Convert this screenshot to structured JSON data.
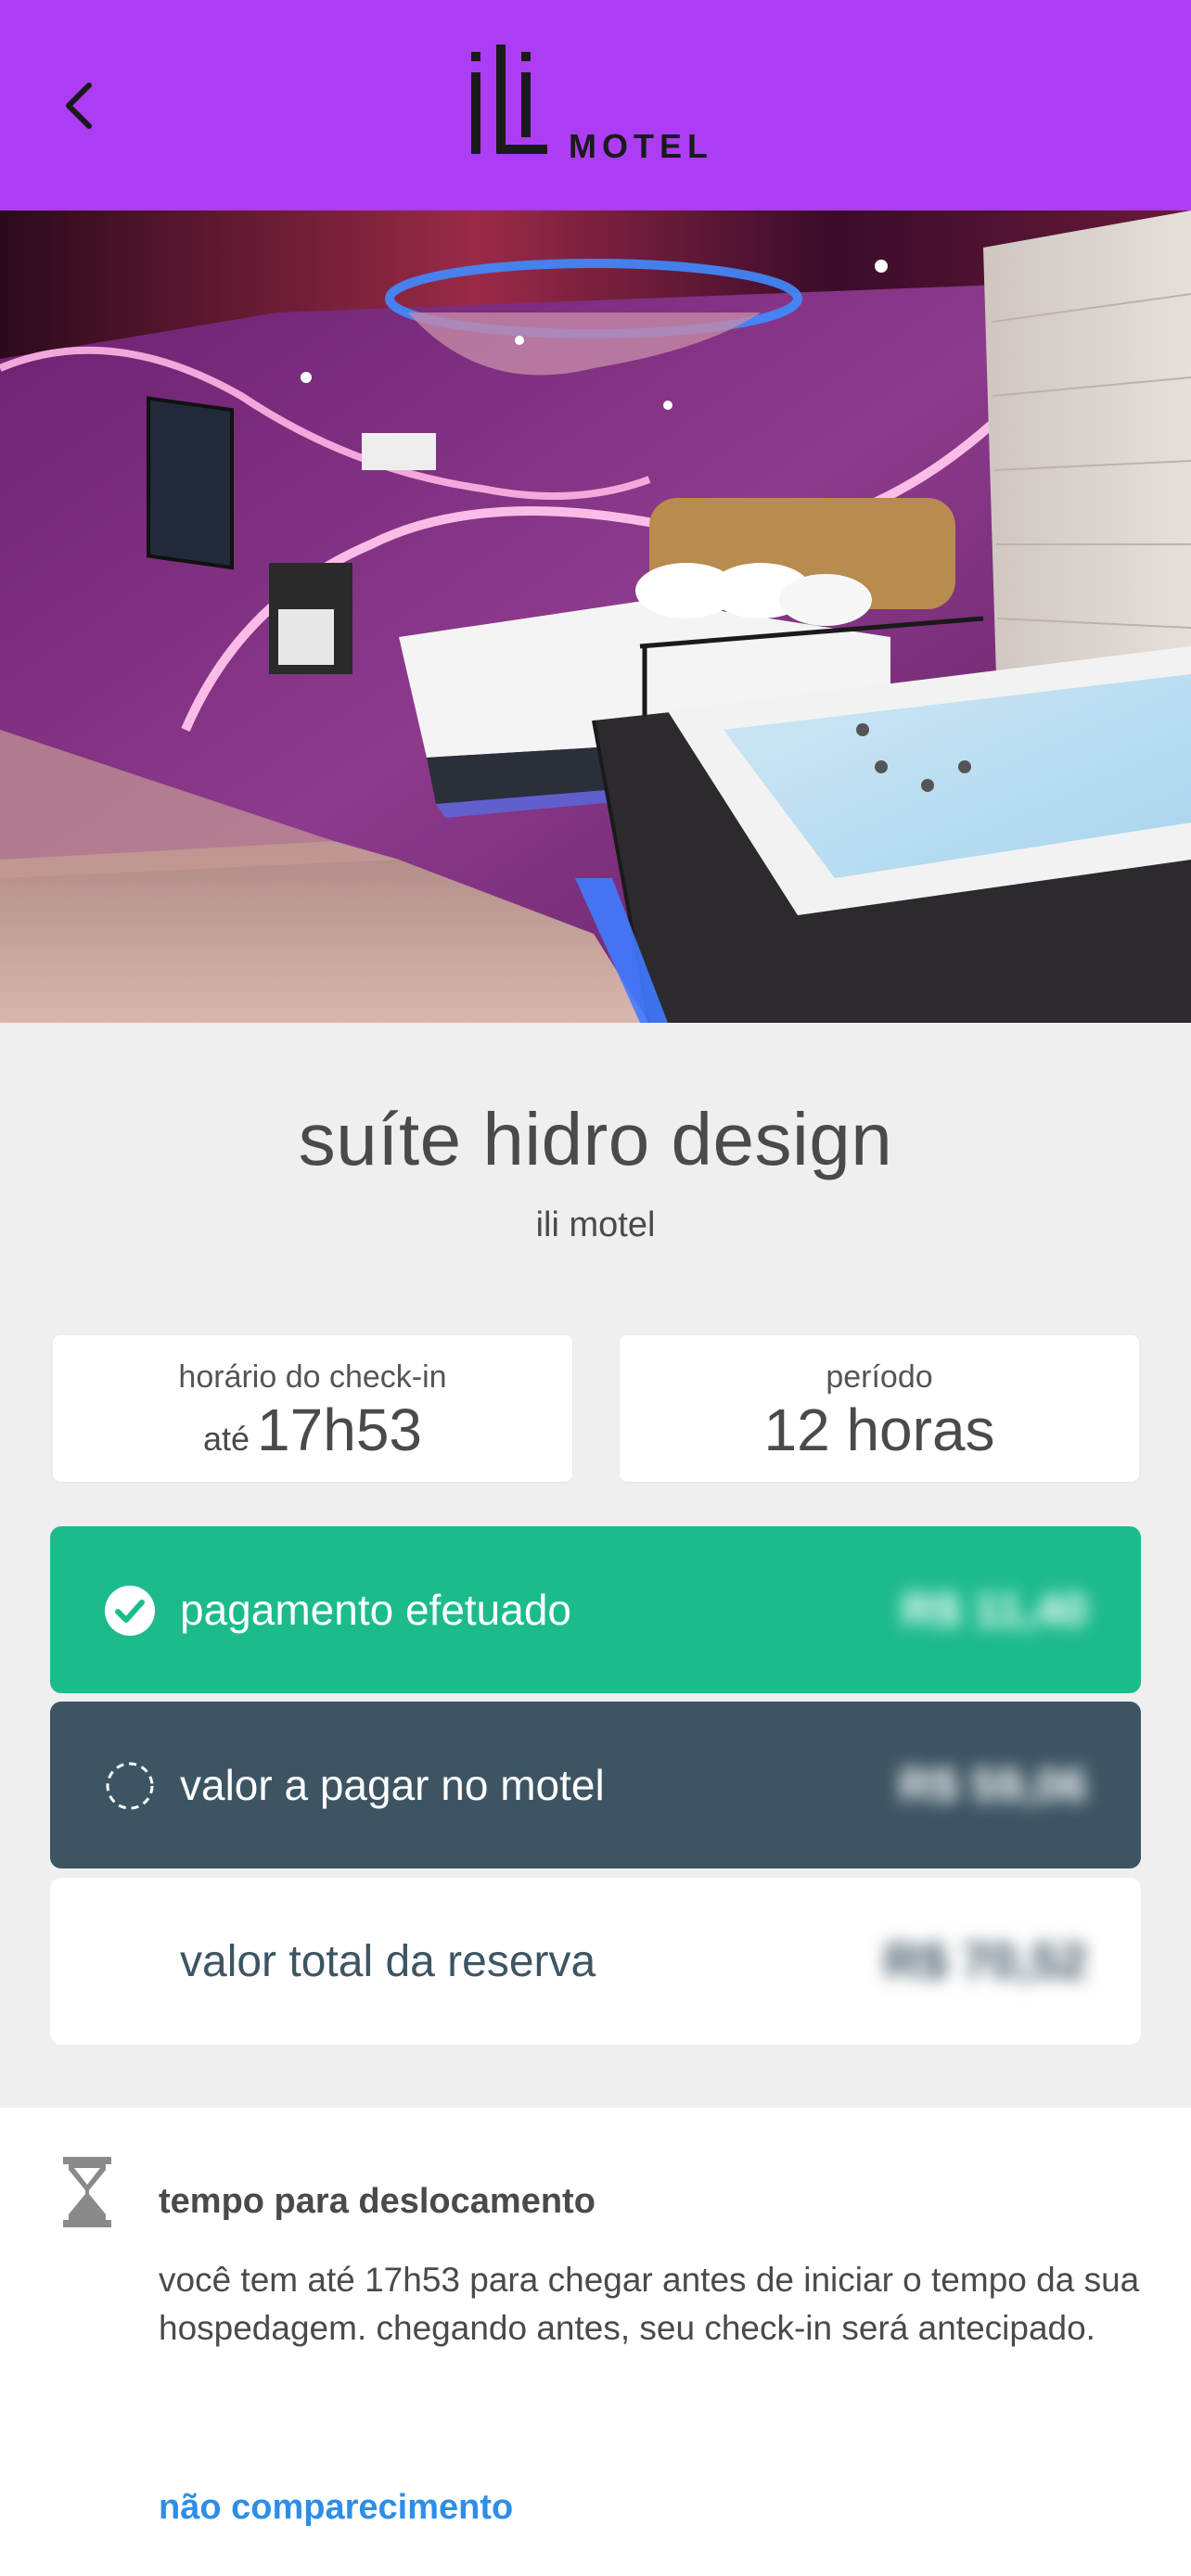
{
  "header": {
    "brand_mark": "iLi",
    "brand_word": "MOTEL",
    "background": "#ad3df5"
  },
  "icons": {
    "back": "chevron-left-icon",
    "paid": "check-circle-icon",
    "due": "dashed-circle-icon",
    "travel": "hourglass-icon"
  },
  "suite": {
    "title": "suíte hidro design",
    "motel": "ili motel"
  },
  "checkin": {
    "label": "horário do check-in",
    "prefix": "até",
    "time": "17h53"
  },
  "period": {
    "label": "período",
    "value": "12 horas"
  },
  "payment": {
    "paid_label": "pagamento efetuado",
    "paid_value": "R$ 11,40",
    "due_label": "valor a pagar no motel",
    "due_value": "R$ 59,06",
    "total_label": "valor total da reserva",
    "total_value": "R$ 70,52",
    "colors": {
      "paid": "#1dbb8c",
      "due": "#3d5563",
      "total_text": "#3d5563"
    }
  },
  "travel": {
    "title": "tempo para deslocamento",
    "description": "você tem até 17h53 para chegar antes de iniciar o tempo da sua hospedagem. chegando antes, seu check-in será antecipado."
  },
  "no_show": {
    "label": "não comparecimento",
    "color": "#2e8ee6"
  }
}
